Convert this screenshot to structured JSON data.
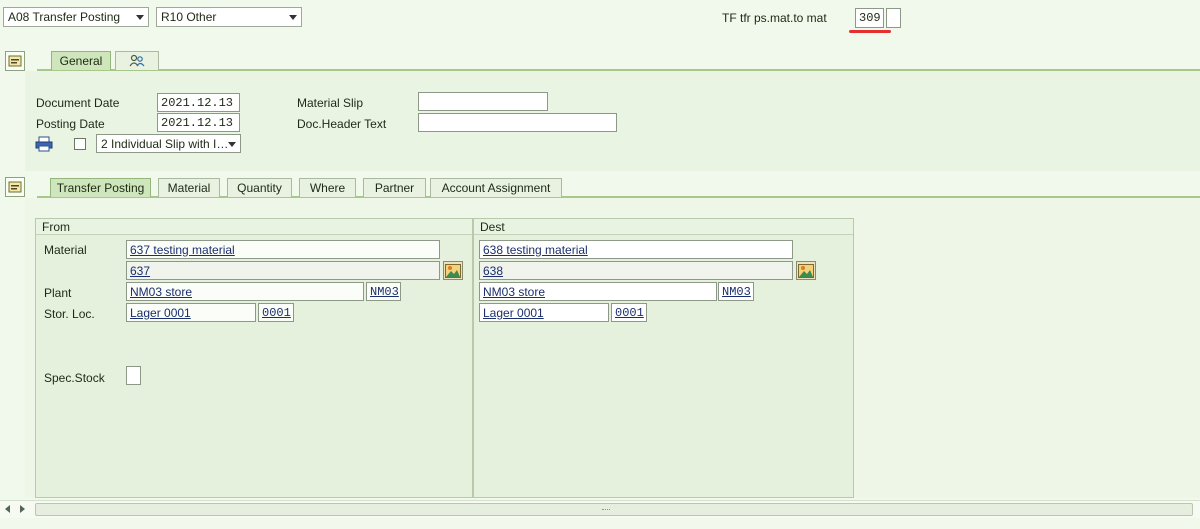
{
  "header": {
    "action_dropdown": "A08 Transfer Posting",
    "reference_dropdown": "R10 Other",
    "movement_type_label": "TF tfr ps.mat.to mat",
    "movement_type_value": "309",
    "movement_type_extra": ""
  },
  "header_tabs": {
    "general": "General",
    "partner_icon": "person-group-icon"
  },
  "general": {
    "document_date_label": "Document Date",
    "document_date": "2021.12.13",
    "posting_date_label": "Posting Date",
    "posting_date": "2021.12.13",
    "material_slip_label": "Material Slip",
    "material_slip": "",
    "doc_header_text_label": "Doc.Header Text",
    "doc_header_text": "",
    "print_option": "2 Individual Slip with I…"
  },
  "item_tabs": [
    "Transfer Posting",
    "Material",
    "Quantity",
    "Where",
    "Partner",
    "Account Assignment"
  ],
  "from": {
    "title": "From",
    "material_label": "Material",
    "material_desc": "637 testing material",
    "material_no": "637",
    "plant_label": "Plant",
    "plant_desc": "NM03 store",
    "plant_code": "NM03",
    "sloc_label": "Stor. Loc.",
    "sloc_desc": "Lager 0001",
    "sloc_code": "0001",
    "spec_stock_label": "Spec.Stock",
    "spec_stock": ""
  },
  "dest": {
    "title": "Dest",
    "material_desc": "638 testing material",
    "material_no": "638",
    "plant_desc": "NM03 store",
    "plant_code": "NM03",
    "sloc_desc": "Lager 0001",
    "sloc_code": "0001"
  },
  "colors": {
    "background": "#f1f8ec",
    "panel": "#e5f0dd",
    "highlight_underline": "#e53030"
  }
}
